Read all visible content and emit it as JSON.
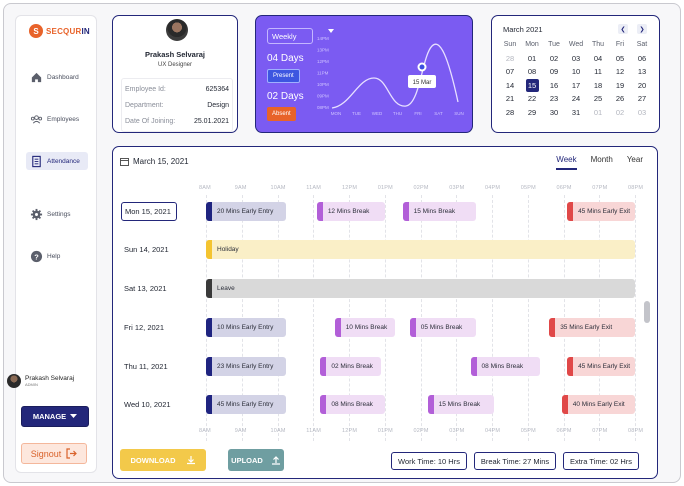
{
  "brand": {
    "mark": "S",
    "name_a": "SECQUR",
    "name_b": "IN"
  },
  "nav": [
    {
      "label": "Dashboard",
      "icon": "home-icon"
    },
    {
      "label": "Employees",
      "icon": "people-icon"
    },
    {
      "label": "Attendance",
      "icon": "document-icon",
      "active": true
    },
    {
      "label": "Settings",
      "icon": "gear-icon"
    },
    {
      "label": "Help",
      "icon": "help-icon"
    }
  ],
  "sidebar_user": {
    "name": "Prakash Selvaraj",
    "role": "ADMIN"
  },
  "manage": {
    "label": "MANAGE"
  },
  "signout": {
    "label": "Signout"
  },
  "profile": {
    "name": "Prakash Selvaraj",
    "role": "UX Designer",
    "fields": [
      {
        "key": "Employee Id:",
        "value": "625364"
      },
      {
        "key": "Department:",
        "value": "Design"
      },
      {
        "key": "Date Of Joining:",
        "value": "25.01.2021"
      }
    ]
  },
  "stats": {
    "period": "Weekly",
    "present_days": "04 Days",
    "present_label": "Present",
    "absent_days": "02 Days",
    "absent_label": "Absent",
    "tooltip": "15 Mar",
    "chart_data": {
      "type": "line",
      "y_ticks": [
        "14PM",
        "13PM",
        "12PM",
        "11PM",
        "10PM",
        "09PM",
        "08PM"
      ],
      "x_ticks": [
        "MON",
        "TUE",
        "WED",
        "THU",
        "FRI",
        "SAT",
        "SUN"
      ],
      "highlight": "15 Mar"
    }
  },
  "calendar": {
    "title": "March 2021",
    "weekdays": [
      "Sun",
      "Mon",
      "Tue",
      "Wed",
      "Thu",
      "Fri",
      "Sat"
    ],
    "days": [
      "28",
      "01",
      "02",
      "03",
      "04",
      "05",
      "06",
      "07",
      "08",
      "09",
      "10",
      "11",
      "12",
      "13",
      "14",
      "15",
      "16",
      "17",
      "18",
      "19",
      "20",
      "21",
      "22",
      "23",
      "24",
      "25",
      "26",
      "27",
      "28",
      "29",
      "30",
      "31",
      "01",
      "02",
      "03"
    ],
    "muted": [
      0,
      32,
      33,
      34
    ],
    "selected": 15
  },
  "schedule": {
    "date": "March 15, 2021",
    "tabs": [
      "Week",
      "Month",
      "Year"
    ],
    "active_tab": "Week",
    "hours": [
      "8AM",
      "9AM",
      "10AM",
      "11AM",
      "12PM",
      "01PM",
      "02PM",
      "03PM",
      "04PM",
      "05PM",
      "06PM",
      "07PM",
      "08PM"
    ],
    "rows": [
      {
        "date": "Mon 15, 2021",
        "current": true,
        "bars": [
          {
            "label": "20 Mins Early Entry",
            "start": 8.0,
            "end": 10.25,
            "color": "#1f2480",
            "bg": "#d3d3e6"
          },
          {
            "label": "12 Mins Break",
            "start": 11.1,
            "end": 13.0,
            "color": "#b25fd8",
            "bg": "#f0ddf5"
          },
          {
            "label": "15 Mins Break",
            "start": 13.5,
            "end": 15.55,
            "color": "#b25fd8",
            "bg": "#f0ddf5"
          },
          {
            "label": "45 Mins Early Exit",
            "start": 18.1,
            "end": 20.0,
            "color": "#e04848",
            "bg": "#f8d6d6"
          }
        ]
      },
      {
        "date": "Sun 14, 2021",
        "bars": [
          {
            "label": "Holiday",
            "start": 8.0,
            "end": 20.0,
            "color": "#f4c430",
            "bg": "#faefc7"
          }
        ]
      },
      {
        "date": "Sat 13, 2021",
        "bars": [
          {
            "label": "Leave",
            "start": 8.0,
            "end": 20.0,
            "color": "#3a3a3a",
            "bg": "#d9d9d9"
          }
        ]
      },
      {
        "date": "Fri 12, 2021",
        "bars": [
          {
            "label": "10 Mins Early Entry",
            "start": 8.0,
            "end": 10.25,
            "color": "#1f2480",
            "bg": "#d3d3e6"
          },
          {
            "label": "10 Mins Break",
            "start": 11.6,
            "end": 13.3,
            "color": "#b25fd8",
            "bg": "#f0ddf5"
          },
          {
            "label": "05 Mins Break",
            "start": 13.7,
            "end": 15.55,
            "color": "#b25fd8",
            "bg": "#f0ddf5"
          },
          {
            "label": "35 Mins Early Exit",
            "start": 17.6,
            "end": 20.0,
            "color": "#e04848",
            "bg": "#f8d6d6"
          }
        ]
      },
      {
        "date": "Thu 11, 2021",
        "bars": [
          {
            "label": "23 Mins Early Entry",
            "start": 8.0,
            "end": 10.25,
            "color": "#1f2480",
            "bg": "#d3d3e6"
          },
          {
            "label": "02 Mins Break",
            "start": 11.2,
            "end": 12.9,
            "color": "#b25fd8",
            "bg": "#f0ddf5"
          },
          {
            "label": "08 Mins Break",
            "start": 15.4,
            "end": 17.35,
            "color": "#b25fd8",
            "bg": "#f0ddf5"
          },
          {
            "label": "45 Mins Early Exit",
            "start": 18.1,
            "end": 20.0,
            "color": "#e04848",
            "bg": "#f8d6d6"
          }
        ]
      },
      {
        "date": "Wed 10, 2021",
        "bars": [
          {
            "label": "45 Mins Early Entry",
            "start": 8.0,
            "end": 10.25,
            "color": "#1f2480",
            "bg": "#d3d3e6"
          },
          {
            "label": "08 Mins Break",
            "start": 11.2,
            "end": 13.0,
            "color": "#b25fd8",
            "bg": "#f0ddf5"
          },
          {
            "label": "15 Mins Break",
            "start": 14.2,
            "end": 16.05,
            "color": "#b25fd8",
            "bg": "#f0ddf5"
          },
          {
            "label": "40 Mins Early Exit",
            "start": 17.95,
            "end": 20.0,
            "color": "#e04848",
            "bg": "#f8d6d6"
          }
        ]
      }
    ]
  },
  "actions": {
    "download": "DOWNLOAD",
    "upload": "UPLOAD"
  },
  "totals": {
    "work": "Work Time: 10 Hrs",
    "break": "Break Time: 27 Mins",
    "extra": "Extra Time: 02 Hrs"
  }
}
